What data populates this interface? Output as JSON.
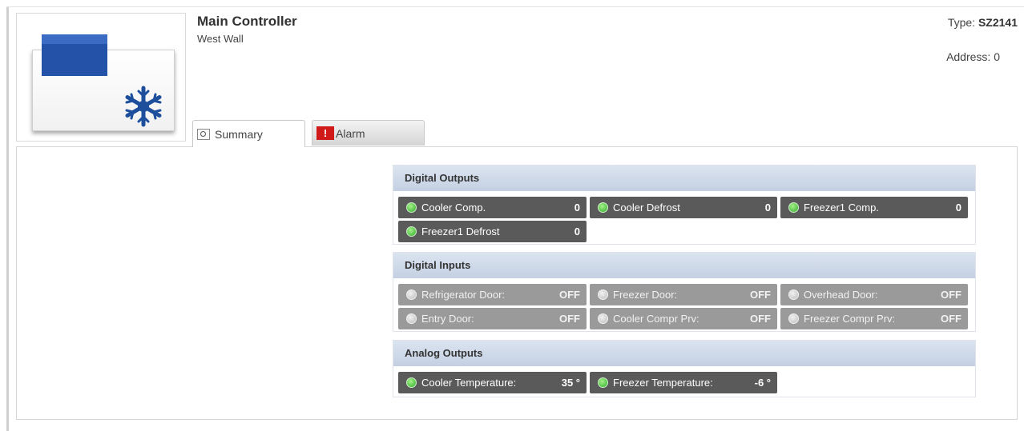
{
  "device": {
    "title": "Main Controller",
    "subtitle": "West Wall",
    "type_label": "Type:",
    "type_value": "SZ2141",
    "address_label": "Address:",
    "address_value": "0"
  },
  "tabs": [
    {
      "label": "Summary",
      "icon": "magnifier-icon",
      "selected": true
    },
    {
      "label": "Alarm",
      "icon": "alarm-icon",
      "selected": false
    }
  ],
  "sections": {
    "digital_outputs": {
      "title": "Digital Outputs",
      "items": [
        {
          "label": "Cooler Comp.",
          "value": "0",
          "status": "green"
        },
        {
          "label": "Cooler Defrost",
          "value": "0",
          "status": "green"
        },
        {
          "label": "Freezer1 Comp.",
          "value": "0",
          "status": "green"
        },
        {
          "label": "Freezer1 Defrost",
          "value": "0",
          "status": "green"
        }
      ]
    },
    "digital_inputs": {
      "title": "Digital Inputs",
      "items": [
        {
          "label": "Refrigerator Door:",
          "value": "OFF",
          "status": "gray"
        },
        {
          "label": "Freezer Door:",
          "value": "OFF",
          "status": "gray"
        },
        {
          "label": "Overhead Door:",
          "value": "OFF",
          "status": "gray"
        },
        {
          "label": "Entry Door:",
          "value": "OFF",
          "status": "gray"
        },
        {
          "label": "Cooler Compr Prv:",
          "value": "OFF",
          "status": "gray"
        },
        {
          "label": "Freezer Compr Prv:",
          "value": "OFF",
          "status": "gray"
        }
      ]
    },
    "analog_outputs": {
      "title": "Analog Outputs",
      "items": [
        {
          "label": "Cooler Temperature:",
          "value": "35 °",
          "status": "green"
        },
        {
          "label": "Freezer Temperature:",
          "value": "-6 °",
          "status": "green"
        }
      ]
    }
  },
  "colors": {
    "section_header": "#c4d0e2",
    "pill_active": "#5a5a5a",
    "pill_inactive": "#9a9a9a",
    "status_green": "#2fae2a",
    "alarm_red": "#d01919",
    "device_blue": "#2352a8"
  }
}
